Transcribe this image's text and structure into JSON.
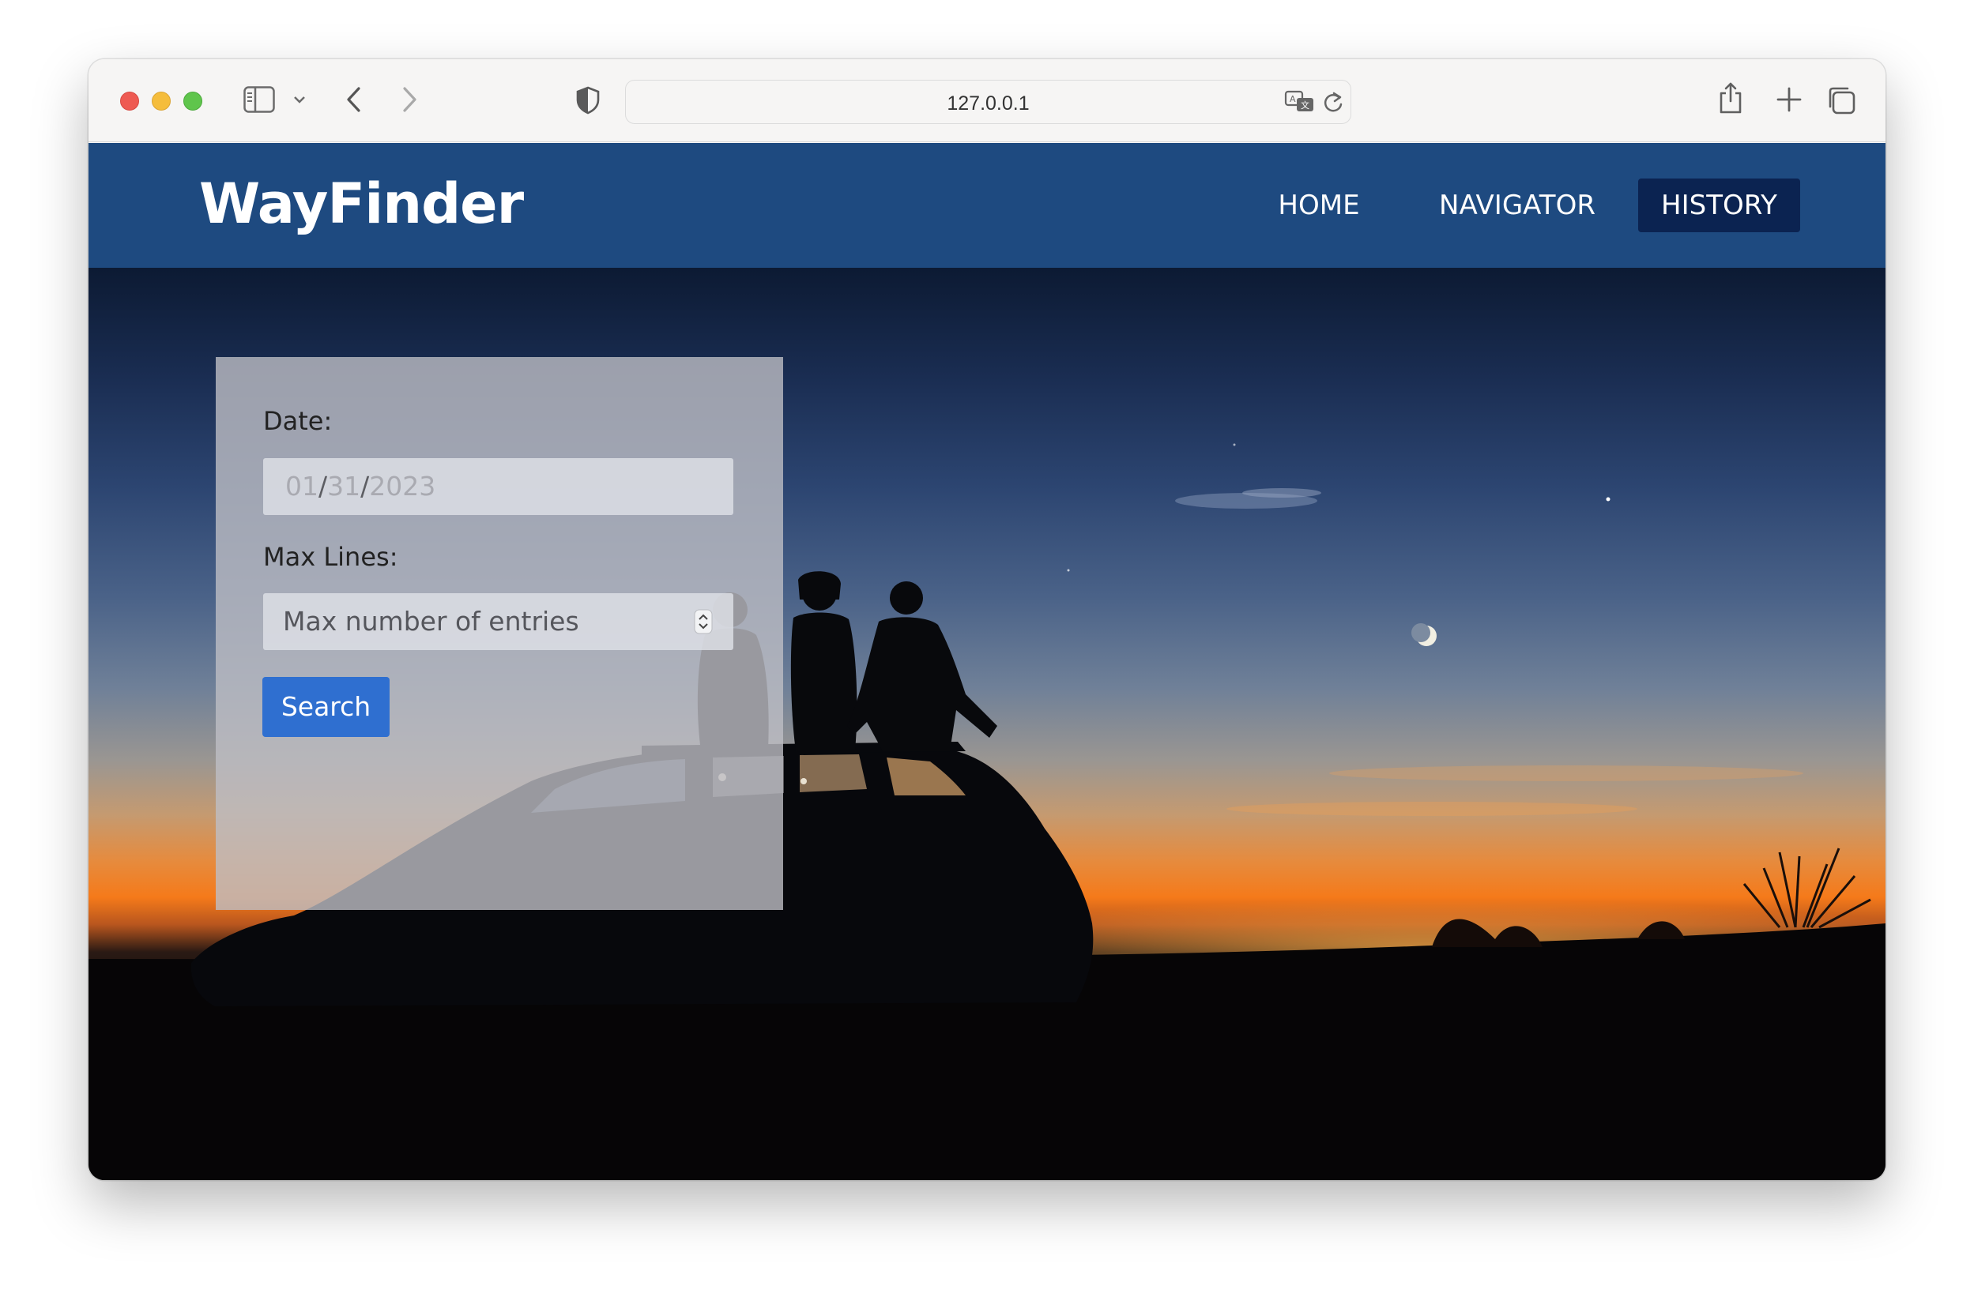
{
  "browser": {
    "url": "127.0.0.1"
  },
  "navbar": {
    "brand": "WayFinder",
    "links": [
      {
        "label": "HOME",
        "active": false
      },
      {
        "label": "NAVIGATOR",
        "active": false
      },
      {
        "label": "HISTORY",
        "active": true
      }
    ]
  },
  "form": {
    "date_label": "Date:",
    "date_value": {
      "month": "01",
      "day": "31",
      "year": "2023",
      "separator": "/"
    },
    "max_lines_label": "Max Lines:",
    "max_lines_placeholder": "Max number of entries",
    "search_label": "Search"
  },
  "colors": {
    "navbar": "#1e4a80",
    "active_nav": "#0b2351",
    "button": "#2f6fd0"
  },
  "icons": [
    "sidebar-icon",
    "chevron-down-icon",
    "back-icon",
    "forward-icon",
    "shield-icon",
    "translate-icon",
    "reload-icon",
    "share-icon",
    "new-tab-icon",
    "tabs-overview-icon",
    "stepper-icon"
  ]
}
